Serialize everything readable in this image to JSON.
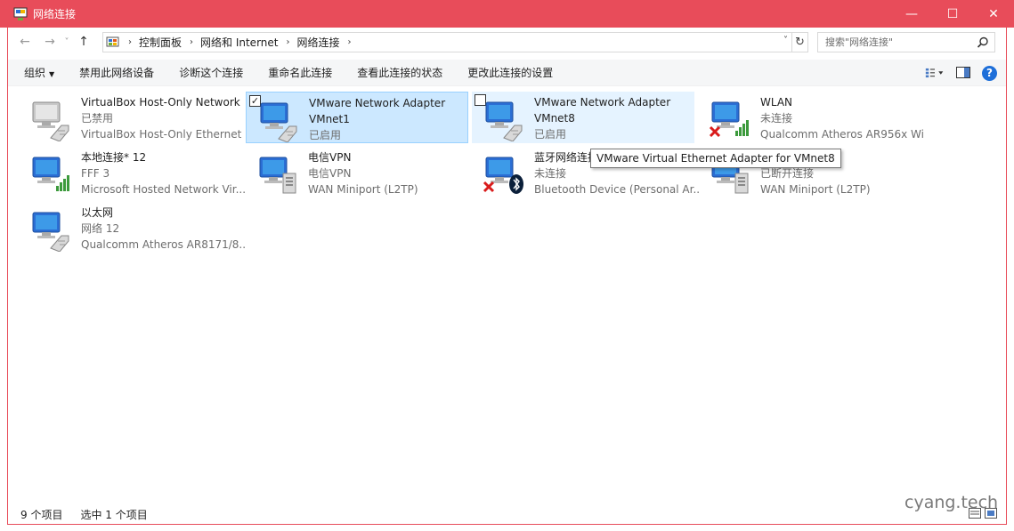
{
  "window": {
    "title": "网络连接",
    "minimize": "—",
    "maximize": "☐",
    "close": "✕"
  },
  "nav": {
    "back": "←",
    "forward": "→",
    "recent": "˅",
    "up": "↑"
  },
  "address": {
    "crumbs": [
      "控制面板",
      "网络和 Internet",
      "网络连接"
    ],
    "separator": "›",
    "dropdown": "˅",
    "refresh": "↻"
  },
  "search": {
    "placeholder": "搜索\"网络连接\""
  },
  "toolbar": {
    "organize": "组织",
    "disable": "禁用此网络设备",
    "diagnose": "诊断这个连接",
    "rename": "重命名此连接",
    "status": "查看此连接的状态",
    "settings": "更改此连接的设置",
    "help": "?"
  },
  "connections": [
    {
      "name": "VirtualBox Host-Only Network",
      "status": "已禁用",
      "device": "VirtualBox Host-Only Ethernet ...",
      "icon": "ethernet-icon"
    },
    {
      "name": "VMware Network Adapter",
      "name2": "VMnet1",
      "status": "已启用",
      "icon": "ethernet-icon"
    },
    {
      "name": "VMware Network Adapter",
      "name2": "VMnet8",
      "status": "已启用",
      "icon": "ethernet-icon"
    },
    {
      "name": "WLAN",
      "status": "未连接",
      "device": "Qualcomm Atheros AR956x Wi...",
      "icon": "wifi-icon"
    },
    {
      "name": "本地连接* 12",
      "status": "FFF  3",
      "device": "Microsoft Hosted Network Vir...",
      "icon": "wifi-icon"
    },
    {
      "name": "电信VPN",
      "status": "电信VPN",
      "device": "WAN Miniport (L2TP)",
      "icon": "vpn-icon"
    },
    {
      "name": "蓝牙网络连接",
      "status": "未连接",
      "device": "Bluetooth Device (Personal Ar...",
      "icon": "bluetooth-icon"
    },
    {
      "name": "",
      "status": "已断开连接",
      "device": "WAN Miniport (L2TP)",
      "icon": "vpn-icon"
    },
    {
      "name": "以太网",
      "status": "网络  12",
      "device": "Qualcomm Atheros AR8171/8...",
      "icon": "ethernet-icon"
    }
  ],
  "tooltip": "VMware Virtual Ethernet Adapter for VMnet8",
  "statusbar": {
    "count": "9 个项目",
    "selected": "选中 1 个项目"
  },
  "watermark": "cyang.tech",
  "colors": {
    "titlebar": "#e84c5a",
    "selected": "#cce8ff",
    "hover": "#e5f3ff",
    "help": "#1e6fd9"
  }
}
